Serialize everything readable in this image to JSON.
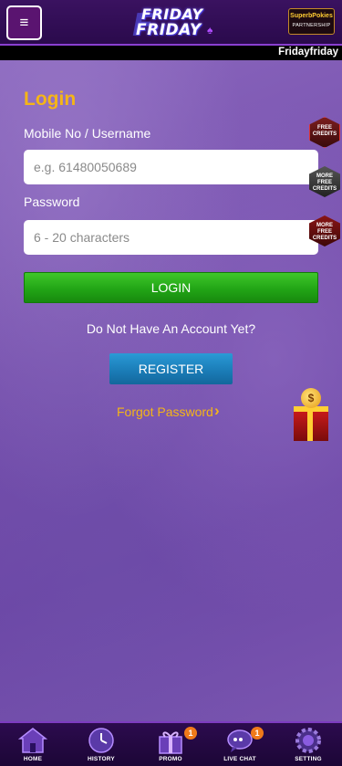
{
  "header": {
    "menu_icon": "≡",
    "logo_line1": "FRIDAY",
    "logo_line2": "FRIDAY",
    "partner_name": "SuperbPokies",
    "partner_sub": "PARTNERSHIP"
  },
  "ticker": {
    "text": "Fridayfriday"
  },
  "login": {
    "title": "Login",
    "username_label": "Mobile No / Username",
    "username_placeholder": "e.g. 61480050689",
    "password_label": "Password",
    "password_placeholder": "6 - 20 characters",
    "login_button": "LOGIN",
    "no_account_text": "Do Not Have An Account Yet?",
    "register_button": "REGISTER",
    "forgot_password": "Forgot Password"
  },
  "side_badges": [
    {
      "text": "FREE CREDITS",
      "icon": "free-credits-badge-icon"
    },
    {
      "text": "MORE FREE CREDITS",
      "icon": "more-free-credits-badge-icon"
    },
    {
      "text": "MORE FREE CREDITS",
      "icon": "more-free-credits-badge-icon"
    }
  ],
  "gift": {
    "icon": "gift-box-icon",
    "coin_symbol": "$"
  },
  "bottom_nav": [
    {
      "label": "HOME",
      "icon": "home-icon",
      "badge": ""
    },
    {
      "label": "HISTORY",
      "icon": "history-icon",
      "badge": ""
    },
    {
      "label": "PROMO",
      "icon": "promo-gift-icon",
      "badge": "1"
    },
    {
      "label": "LIVE CHAT",
      "icon": "live-chat-icon",
      "badge": "1"
    },
    {
      "label": "SETTING",
      "icon": "settings-gear-icon",
      "badge": ""
    }
  ],
  "colors": {
    "accent_gold": "#f5b517",
    "login_green": "#22a516",
    "register_blue": "#1b7db8",
    "header_purple": "#2a0a4c",
    "background_purple": "#7d5ab0"
  }
}
